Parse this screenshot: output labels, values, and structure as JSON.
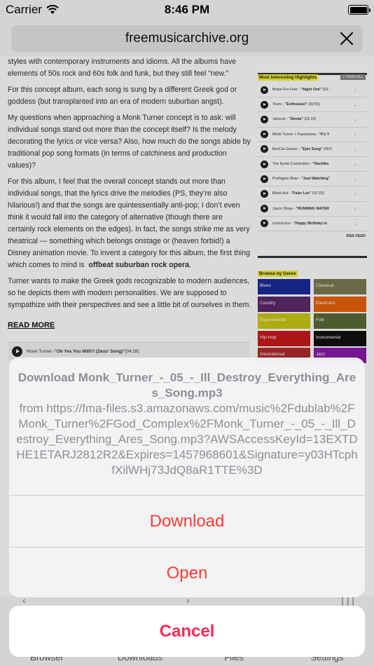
{
  "status_bar": {
    "carrier": "Carrier",
    "time": "8:46 PM"
  },
  "browser": {
    "url": "freemusicarchive.org"
  },
  "article": {
    "paragraphs": [
      "styles with contemporary instruments and idioms.  All the albums have elements of 50s  rock and 60s folk and funk, but they still feel “new.”",
      "For this concept album, each song is sung by a different Greek god or goddess (but transplanted into an era of modern suburban angst).",
      "My questions when approaching a Monk Turner concept is to ask: will individual songs stand out more than the concept itself?  Is the melody decorating the lyrics or vice versa? Also, how much do the songs abide by traditional pop song formats (in terms of catchiness and production values)?",
      "For this album, I feel that the overall concept stands out more than individual songs, that the lyrics drive  the melodies (PS, they’re also hilarious!) and that the songs are quintessentially anti-pop; I don’t even think it would fall into the category of alternative (though there are certainly rock elements on the edges). In fact, the songs strike me as very theatrical — something which belongs  onstage or (heaven forbid!)  a Disney animation movie. To invent a category for this album, the first thing which comes to mind is",
      "Turner wants to make the Greek gods recognizable to modern audiences, so he depicts them with  modern personalities. We are supposed to sympathize with their perspectives and  see a little bit of ourselves in them."
    ],
    "bold_phrase": "offbeat suburban rock opera",
    "read_more": "READ MORE",
    "track": {
      "artist": "Monk Turner - ",
      "title": "\"Oh Yes You Will!!! (Zeus' Song)\"",
      "duration": " (04:28)"
    }
  },
  "sidebar": {
    "highlights_title": "Most Interesting Highlights",
    "view_all": "+ VIEW ALL",
    "highlights": [
      {
        "artist": "Broke For Free - ",
        "title": "\"Night Owl\"",
        "duration": " (03:"
      },
      {
        "artist": "Tours - ",
        "title": "\"Enthusiast\"",
        "duration": " (02:55)"
      },
      {
        "artist": "Jahzzar - ",
        "title": "\"Siesta\"",
        "duration": " (02:19)"
      },
      {
        "artist": "Monk Turner + Fascinoma - ",
        "title": "\"It's Y",
        "duration": ""
      },
      {
        "artist": "BoxCat Games - ",
        "title": "\"Epic Song\"",
        "duration": " (00:5"
      },
      {
        "artist": "The Kyoto Connection - ",
        "title": "\"Hachiko",
        "duration": ""
      },
      {
        "artist": "Podington Bear - ",
        "title": "\"Just Watching\"",
        "duration": ""
      },
      {
        "artist": "Black Ant - ",
        "title": "\"Fater Lee\"",
        "duration": " (02:23)"
      },
      {
        "artist": "Jason Shaw - ",
        "title": "\"RUNNING WATER",
        "duration": ""
      },
      {
        "artist": "sorinsrzica - ",
        "title": "\"Happy Birthday to",
        "duration": ""
      }
    ],
    "rss": "RSS FEED",
    "genre_title": "Browse by Genre",
    "genres": [
      {
        "name": "Blues",
        "color": "#1a2c9b"
      },
      {
        "name": "Classical",
        "color": "#7b7b52"
      },
      {
        "name": "Country",
        "color": "#5b2a6b"
      },
      {
        "name": "Electronic",
        "color": "#e8640a"
      },
      {
        "name": "Experimental",
        "color": "#c9c914"
      },
      {
        "name": "Folk",
        "color": "#5a6b3a"
      },
      {
        "name": "Hip-Hop",
        "color": "#c91a1a"
      },
      {
        "name": "Instrumental",
        "color": "#111111"
      },
      {
        "name": "International",
        "color": "#b22a2a"
      },
      {
        "name": "Jazz",
        "color": "#8a1aa8"
      }
    ]
  },
  "action_sheet": {
    "title": "Download Monk_Turner_-_05_-_Ill_Destroy_Everything_Ares_Song.mp3",
    "message": "from https://fma-files.s3.amazonaws.com/music%2Fdublab%2FMonk_Turner%2FGod_Complex%2FMonk_Turner_-_05_-_Ill_Destroy_Everything_Ares_Song.mp3?AWSAccessKeyId=13EXTDHE1ETARJ2812R2&Expires=1457968601&Signature=y03HTcphfXilWHj73JdQ8aR1TTE%3D",
    "download": "Download",
    "open": "Open",
    "cancel": "Cancel"
  },
  "tabs": [
    "Browser",
    "Downloads",
    "Files",
    "Settings"
  ],
  "colors": {
    "destructive": "#ff3b30",
    "cancel": "#ff2d55",
    "highlight": "#f6f13c"
  }
}
